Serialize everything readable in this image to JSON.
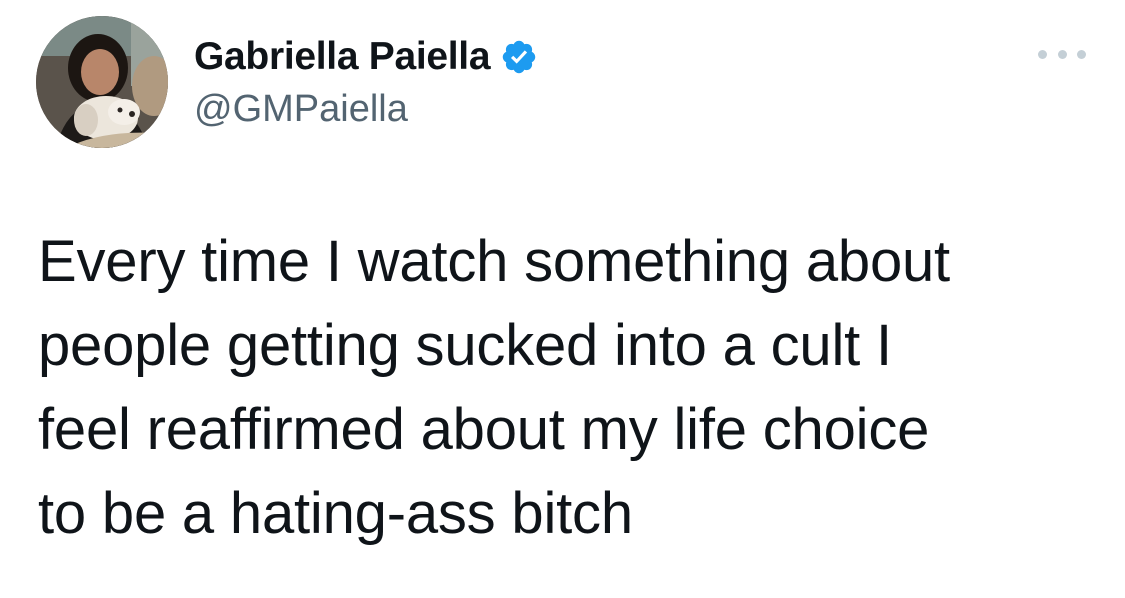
{
  "tweet": {
    "author": {
      "display_name": "Gabriella Paiella",
      "handle": "@GMPaiella",
      "verified": true,
      "avatar_icon": "profile-photo-with-dog"
    },
    "more_icon": "more-horizontal-icon",
    "text_lines": [
      "Every time I watch something about",
      "people getting sucked into a cult I",
      "feel reaffirmed about my life choice",
      "to be a hating-ass bitch"
    ]
  },
  "colors": {
    "verified_badge": "#1d9bf0",
    "primary_text": "#0f1419",
    "secondary_text": "#536471",
    "more_dots": "#c4cfd6"
  }
}
